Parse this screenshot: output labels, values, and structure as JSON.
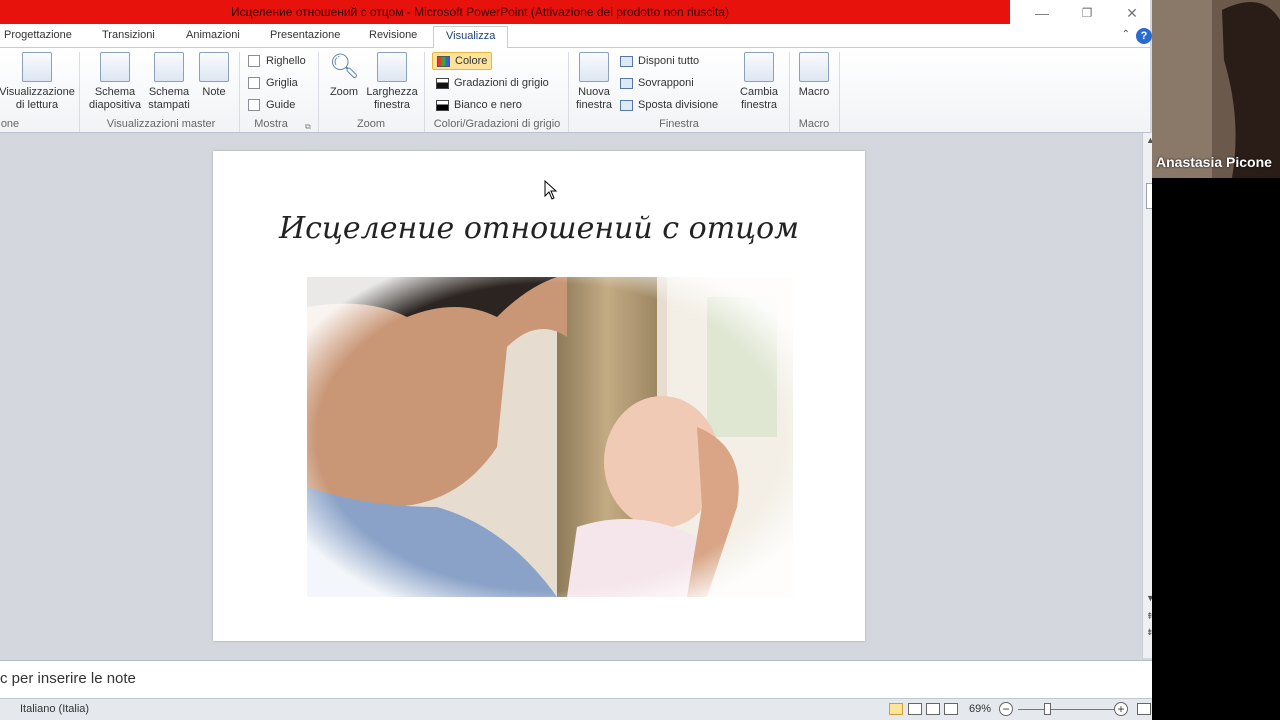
{
  "window": {
    "title": "Исцеление отношений с отцом - Microsoft PowerPoint (Attivazione del prodotto non riuscita)",
    "minimize": "—",
    "restore": "❐",
    "close": "✕"
  },
  "tabs": [
    "Progettazione",
    "Transizioni",
    "Animazioni",
    "Presentazione",
    "Revisione",
    "Visualizza"
  ],
  "active_tab": "Visualizza",
  "ribbon": {
    "reading_view": "Visualizzazione\ndi lettura",
    "group_presentation_views": "one",
    "slide_master": "Schema\ndiapositiva",
    "handout_master": "Schema\nstampati",
    "notes_master": "Note",
    "group_master_views": "Visualizzazioni master",
    "ruler": "Righello",
    "grid": "Griglia",
    "guides": "Guide",
    "group_show": "Mostra",
    "zoom": "Zoom",
    "fit_window": "Larghezza\nfinestra",
    "group_zoom": "Zoom",
    "color": "Colore",
    "grayscale": "Gradazioni di grigio",
    "black_white": "Bianco e nero",
    "group_color": "Colori/Gradazioni di grigio",
    "new_window": "Nuova\nfinestra",
    "arrange_all": "Disponi tutto",
    "cascade": "Sovrapponi",
    "move_split": "Sposta divisione",
    "switch_windows": "Cambia\nfinestra",
    "group_window": "Finestra",
    "macros": "Macro",
    "group_macros": "Macro"
  },
  "slide": {
    "title": "Исцеление отношений с отцом"
  },
  "notes": {
    "placeholder": "c per inserire le note"
  },
  "status": {
    "language": "Italiano (Italia)",
    "zoom": "69%"
  },
  "webcam": {
    "participant": "Anastasia Picone"
  },
  "colors": {
    "title_bar": "#e8120c",
    "active_highlight": "#fde39b",
    "help": "#2a6bd1"
  }
}
